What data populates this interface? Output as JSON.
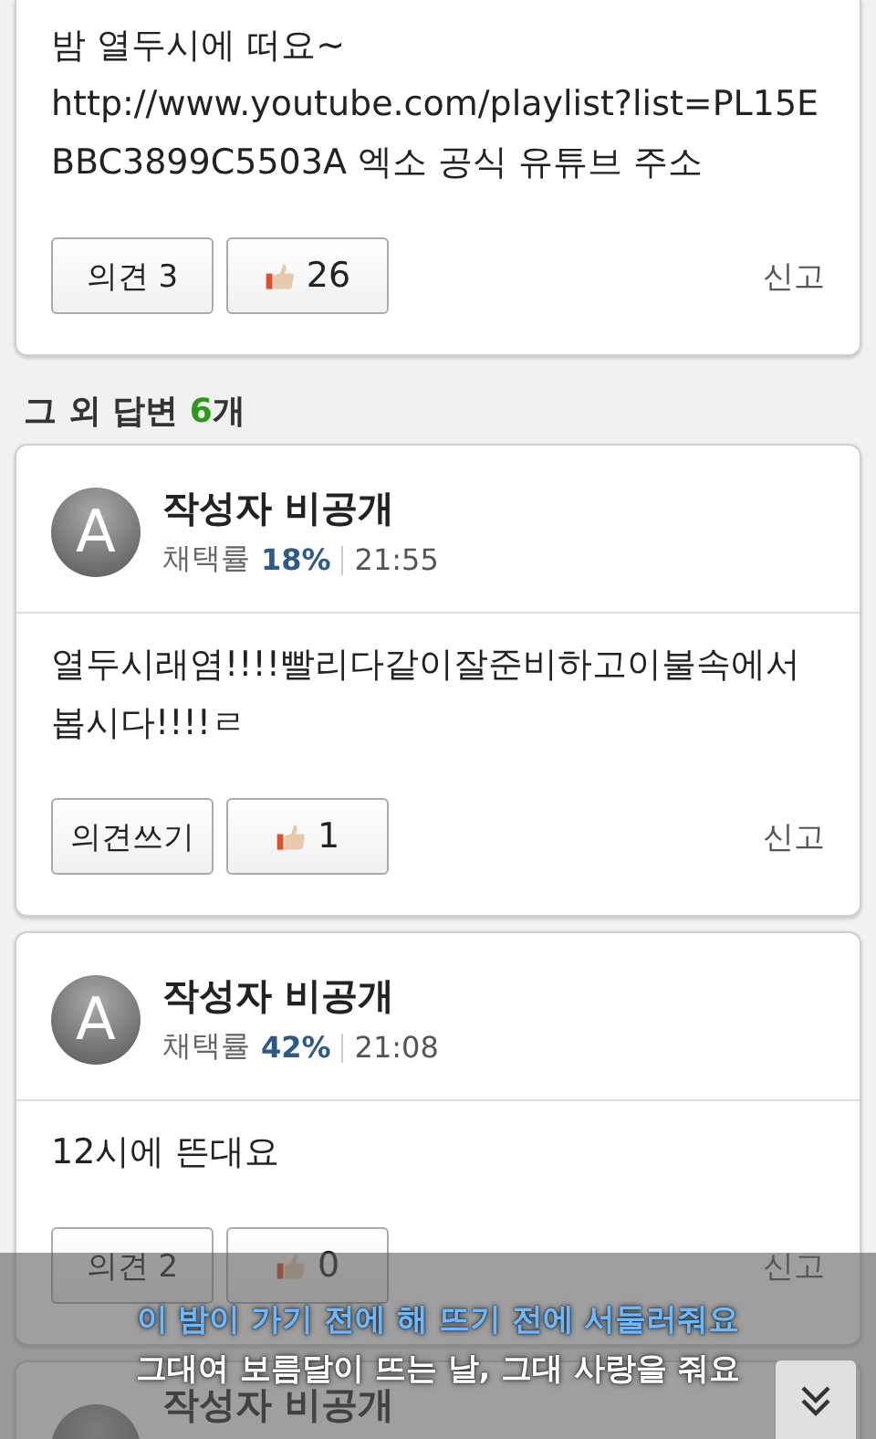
{
  "first_answer": {
    "lines": [
      "밤 열두시에 떠요~",
      "http://www.youtube.com/playlist?list=PL15EBBC3899C5503A 엑소 공식 유튜브 주소"
    ],
    "comment_button": "의견 3",
    "like_count": "26",
    "report": "신고"
  },
  "section_heading": {
    "prefix": "그 외 답변",
    "count": "6",
    "suffix": "개"
  },
  "answers": [
    {
      "avatar": "A",
      "author": "작성자 비공개",
      "rate_label": "채택률",
      "rate": "18%",
      "time": "21:55",
      "body": "열두시래염!!!!빨리다같이잘준비하고이불속에서봅시다!!!!ㄹ",
      "comment_button": "의견쓰기",
      "like_count": "1",
      "report": "신고"
    },
    {
      "avatar": "A",
      "author": "작성자 비공개",
      "rate_label": "채택률",
      "rate": "42%",
      "time": "21:08",
      "body": "12시에 뜬대요",
      "comment_button": "의견 2",
      "like_count": "0",
      "report": "신고"
    },
    {
      "author": "작성자 비공개"
    }
  ],
  "lyrics": [
    {
      "text": "이 밤이 가기 전에 해 뜨기 전에 서둘러줘요",
      "selected": true
    },
    {
      "text": "그대여 보름달이 뜨는 날, 그대 사랑을 줘요",
      "selected": false
    }
  ]
}
